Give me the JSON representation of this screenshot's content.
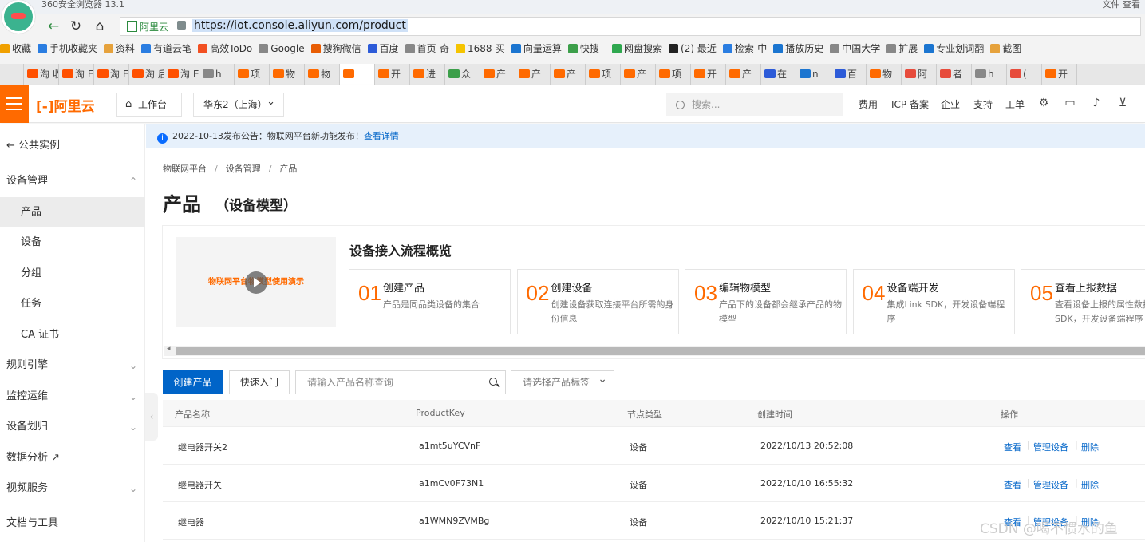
{
  "browser": {
    "title": "360安全浏览器 13.1",
    "top_right": "文件  查看",
    "site_badge": "阿里云",
    "url": "https://iot.console.aliyun.com/product",
    "bookmarks": [
      "收藏",
      "手机收藏夹",
      "资料",
      "有道云笔",
      "高效ToDo",
      "Google",
      "搜狗微信",
      "百度",
      "首页-奇",
      "1688-买",
      "向量运算",
      "快搜 - ",
      "网盘搜索",
      "(2) 最近",
      "检索-中",
      "播放历史",
      "中国大学",
      "扩展",
      "专业划词翻",
      "截图"
    ],
    "tabs": [
      "淘 收",
      "淘 E",
      "淘 E",
      "淘 后",
      "淘 E",
      "h",
      "项",
      "物",
      "物",
      "",
      "开",
      "进",
      "众",
      "产",
      "产",
      "产",
      "项",
      "产",
      "项",
      "开",
      "产",
      "在",
      "n",
      "百",
      "物",
      "阿",
      "者",
      "h",
      "(",
      "开"
    ]
  },
  "topnav": {
    "logo": "[-]阿里云",
    "workbench": "工作台",
    "region": "华东2（上海）",
    "search_placeholder": "搜索...",
    "links": [
      "费用",
      "ICP 备案",
      "企业",
      "支持",
      "工单"
    ]
  },
  "sidebar": {
    "back": "公共实例",
    "items": [
      {
        "label": "设备管理",
        "type": "group",
        "chevron": "⌃"
      },
      {
        "label": "产品",
        "type": "sub",
        "active": true
      },
      {
        "label": "设备",
        "type": "sub"
      },
      {
        "label": "分组",
        "type": "sub"
      },
      {
        "label": "任务",
        "type": "sub"
      },
      {
        "label": "CA 证书",
        "type": "sub"
      },
      {
        "label": "规则引擎",
        "type": "group",
        "chevron": "⌄"
      },
      {
        "label": "监控运维",
        "type": "group",
        "chevron": "⌄"
      },
      {
        "label": "设备划归",
        "type": "group",
        "chevron": "⌄"
      },
      {
        "label": "数据分析 ↗",
        "type": "group"
      },
      {
        "label": "视频服务",
        "type": "group",
        "chevron": "⌄"
      },
      {
        "label": "文档与工具",
        "type": "group"
      }
    ]
  },
  "notice": {
    "text": "2022-10-13发布公告：物联网平台新功能发布！",
    "link": "查看详情"
  },
  "breadcrumb": [
    "物联网平台",
    "设备管理",
    "产品"
  ],
  "page": {
    "title": "产品",
    "subtitle": "（设备模型）"
  },
  "guide": {
    "video_caption": "物联网平台物模型使用演示",
    "title": "设备接入流程概览",
    "steps": [
      {
        "num": "01",
        "title": "创建产品",
        "desc": "产品是同品类设备的集合"
      },
      {
        "num": "02",
        "title": "创建设备",
        "desc": "创建设备获取连接平台所需的身份信息"
      },
      {
        "num": "03",
        "title": "编辑物模型",
        "desc": "产品下的设备都会继承产品的物模型"
      },
      {
        "num": "04",
        "title": "设备端开发",
        "desc": "集成Link SDK，开发设备端程序"
      },
      {
        "num": "05",
        "title": "查看上报数据",
        "desc": "查看设备上报的属性数据 SDK，开发设备端程序"
      }
    ]
  },
  "toolbar": {
    "create": "创建产品",
    "quick": "快速入门",
    "search_placeholder": "请输入产品名称查询",
    "tag_placeholder": "请选择产品标签"
  },
  "table": {
    "headers": [
      "产品名称",
      "ProductKey",
      "节点类型",
      "创建时间",
      "操作"
    ],
    "rows": [
      {
        "name": "继电器开关2",
        "key": "a1mt5uYCVnF",
        "node": "设备",
        "time": "2022/10/13 20:52:08"
      },
      {
        "name": "继电器开关",
        "key": "a1mCv0F73N1",
        "node": "设备",
        "time": "2022/10/10 16:55:32"
      },
      {
        "name": "继电器",
        "key": "a1WMN9ZVMBg",
        "node": "设备",
        "time": "2022/10/10 15:21:37"
      }
    ],
    "actions": [
      "查看",
      "管理设备",
      "删除"
    ]
  },
  "watermark": "CSDN @喝不惯水的鱼",
  "colors": {
    "brand": "#ff6a00",
    "primary": "#0064c8",
    "notice_bg": "#e6f0fb"
  }
}
